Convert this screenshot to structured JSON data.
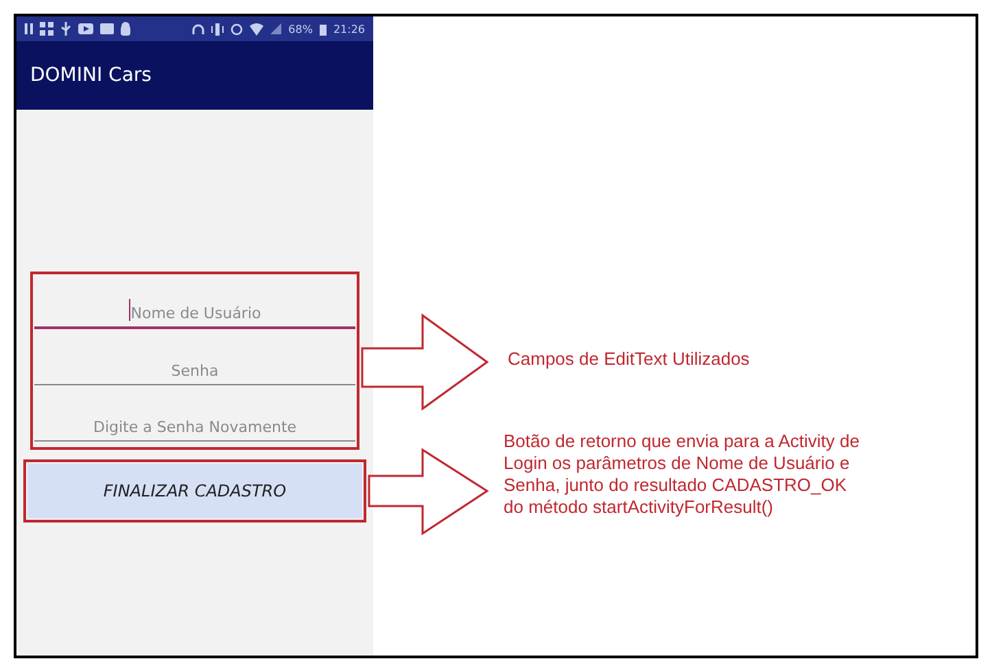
{
  "status_bar": {
    "battery": "68%",
    "time": "21:26"
  },
  "app_bar": {
    "title": "DOMINI Cars"
  },
  "fields": [
    {
      "placeholder": "Nome de Usuário",
      "focused": true
    },
    {
      "placeholder": "Senha",
      "focused": false
    },
    {
      "placeholder": "Digite a Senha Novamente",
      "focused": false
    }
  ],
  "button": {
    "label": "FINALIZAR CADASTRO"
  },
  "annotations": [
    {
      "text": "Campos de EditText Utilizados"
    },
    {
      "text": "Botão de retorno que envia para a Activity de\nLogin os parâmetros de Nome de Usuário e\nSenha, junto do resultado CADASTRO_OK\ndo método startActivityForResult()"
    }
  ]
}
